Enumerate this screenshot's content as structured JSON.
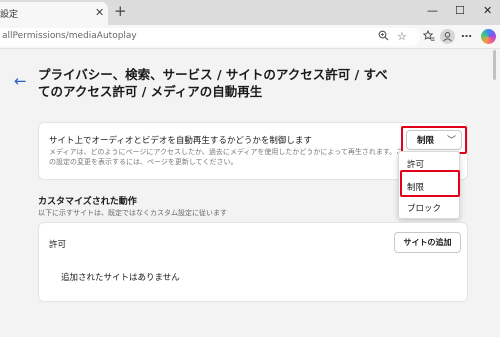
{
  "tab": {
    "title": "設定",
    "close": "✕",
    "new_tab": "+"
  },
  "window_controls": {
    "minimize": "—",
    "maximize": "☐",
    "close": "✕"
  },
  "address_bar": {
    "url": "allPermissions/mediaAutoplay"
  },
  "page": {
    "breadcrumb": "プライバシー、検索、サービス / サイトのアクセス許可 / すべてのアクセス許可 / メディアの自動再生",
    "autoplay": {
      "title": "サイト上でオーディオとビデオを自動再生するかどうかを制御します",
      "description": "メディアは、どのようにページにアクセスしたか、過去にメディアを使用したかどうかによって再生されます。この設定の変更を表示するには、ページを更新してください。",
      "selected": "制限",
      "options": [
        "許可",
        "制限",
        "ブロック"
      ]
    },
    "custom": {
      "title": "カスタマイズされた動作",
      "description": "以下に示すサイトは、既定ではなくカスタム設定に従います"
    },
    "allow": {
      "label": "許可",
      "add_site_button": "サイトの追加",
      "empty_message": "追加されたサイトはありません"
    }
  },
  "icons": {
    "back": "back-arrow-icon",
    "zoom": "zoom-icon",
    "favorite": "star-icon",
    "collections": "favorites-icon",
    "profile": "profile-icon",
    "more": "more-icon",
    "copilot": "copilot-icon"
  },
  "colors": {
    "accent": "#2a62c0",
    "highlight": "#e3001b",
    "background": "#f3f3f3"
  }
}
